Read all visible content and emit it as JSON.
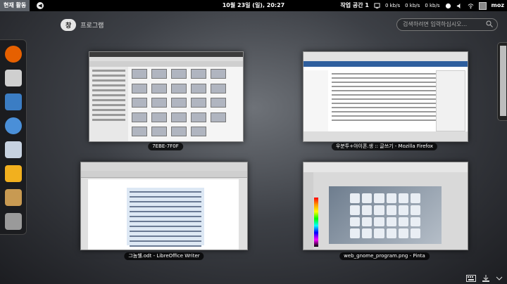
{
  "topbar": {
    "activities": "현재 활동",
    "clock": "10월 23일 (일), 20:27",
    "workspace": "작업 공간 1",
    "net_down": "0 kb/s",
    "net_up": "0 kb/s",
    "net_down2": "0 kb/s",
    "user": "moz"
  },
  "view_selector": {
    "windows_tab": "창",
    "apps_tab": "프로그램"
  },
  "search": {
    "placeholder": "검색하려면 입력하십시오..."
  },
  "windows": [
    {
      "title": "7EBE-7F0F"
    },
    {
      "title": "우분투+아이폰.생 :: 글쓰기 - Mozilla Firefox"
    },
    {
      "title": "그놈쉘.odt - LibreOffice Writer"
    },
    {
      "title": "web_gnome_program.png - Pinta"
    }
  ],
  "dash_apps": [
    {
      "name": "firefox-icon",
      "color": "#e66000"
    },
    {
      "name": "file-manager-icon",
      "color": "#cfcfcf"
    },
    {
      "name": "libreoffice-writer-icon",
      "color": "#3b7dc4"
    },
    {
      "name": "qbittorrent-icon",
      "color": "#4a8fd8"
    },
    {
      "name": "inkscape-icon",
      "color": "#c7d2e0"
    },
    {
      "name": "blog-app-icon",
      "color": "#f2b01e"
    },
    {
      "name": "archive-icon",
      "color": "#c89a52"
    },
    {
      "name": "settings-tool-icon",
      "color": "#9a9a9a"
    }
  ]
}
